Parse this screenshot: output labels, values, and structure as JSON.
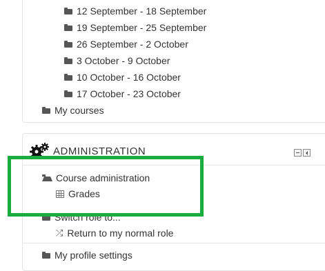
{
  "navigation": {
    "weeks": [
      "12 September - 18 September",
      "19 September - 25 September",
      "26 September - 2 October",
      "3 October - 9 October",
      "10 October - 16 October",
      "17 October - 23 October"
    ],
    "my_courses": "My courses"
  },
  "administration": {
    "title": "ADMINISTRATION",
    "course_admin": "Course administration",
    "grades": "Grades",
    "switch_role": "Switch role to...",
    "return_role": "Return to my normal role",
    "profile_settings": "My profile settings"
  },
  "colors": {
    "highlight": "#1aac3f",
    "icon": "#555555"
  }
}
